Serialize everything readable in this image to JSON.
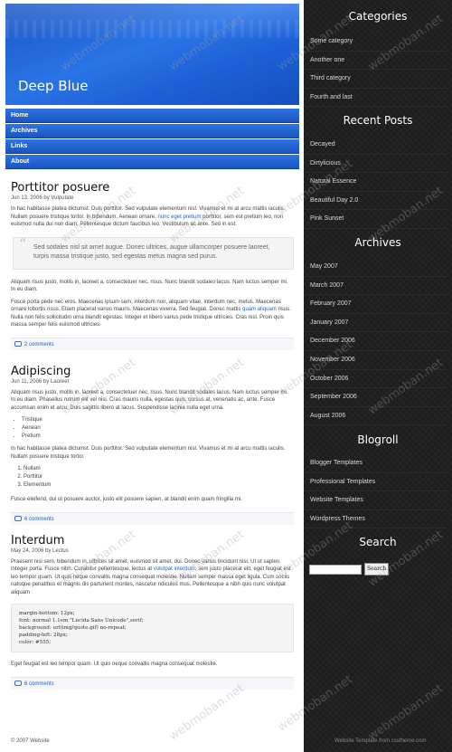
{
  "header": {
    "site_title": "Deep Blue"
  },
  "nav": {
    "items": [
      {
        "label": "Home"
      },
      {
        "label": "Archives"
      },
      {
        "label": "Links"
      },
      {
        "label": "About"
      }
    ]
  },
  "posts": [
    {
      "title": "Porttitor posuere",
      "meta": "Jun 13, 2006 by Vulputate",
      "p1_start": "In hac habitasse platea dictumst. Duis porttitor. Sed vulputate elementum nisl. Vivamus et mi at arcu mattis iaculis. Nullam posuere tristique tortor. In bibendum. Aenean ornare, ",
      "p1_link": "nunc eget pretium",
      "p1_end": " porttitor, sem est pretium leo, non euismod nulla dui non diam. Pellentesque dictum faucibus leo. Vestibulum ac ante. Sed in est.",
      "quote": "Sed sodales nisl sit amet augue. Donec ultrices, augue ullamcorper posuere laoreet, turpis massa tristique justo, sed egestas metus magna sed purus.",
      "p2": "Aliquam risus justo, mollis in, laoreet a, consectetuer nec, risus. Nunc blandit sodales lacus. Nam luctus semper mi. In eu diam.",
      "p3_start": "Fusce porta pede nec eros. Maecenas ipsum sem, interdum non, aliquam vitae, interdum nec, metus. Maecenas ornare lobortis risus. Etiam placerat varius mauris. Maecenas viverra. Sed feugiat. Donec mattis ",
      "p3_link": "quam aliquam",
      "p3_end": " risus. Nulla non felis sollicitudin urna blandit egestas. Integer et libero varius pede tristique ultricies. Cras nisl. Proin quis massa semper felis euismod ultricies.",
      "comments": "2 comments"
    },
    {
      "title": "Adipiscing",
      "meta": "Jun 11, 2006 by Laoreet",
      "p1": "Aliquam risus justo, mollis in, laoreet a, consectetuer nec, risus. Nunc blandit sodales lacus. Nam luctus semper mi. In eu diam. Phasellus rutrum elit vel nisi. Cras mauris nulla, egestas quis, cursus at, venenatis ac, ante. Fusce accumsan enim et arcu. Duis sagittis libero at lacus. Suspendisse lacinia nulla eget urna.",
      "bullets": [
        "Tristique",
        "Aenean",
        "Pretium"
      ],
      "p2": "In hac habitasse platea dictumst. Duis porttitor. Sed vulputate elementum nisl. Vivamus et mi at arcu mattis iaculis. Nullam posuere tristique tortor.",
      "numbered": [
        "Nullam",
        "Porttitor",
        "Elementum"
      ],
      "p3": "Fusce eleifend, dui ut posuere auctor, justo elit posuere sapien, at blandit enim quam fringilla mi.",
      "comments": "6 comments"
    },
    {
      "title": "Interdum",
      "meta": "May 24, 2006 by Lectus",
      "p1_start": "Praesent nisi sem, bibendum in, ultrices sit amet, euismod sit amet, dui. Donec varius tincidunt nisi. Ut ut sapien. Integer porta. Fusce nibh. Curabitur pellentesque, lectus at ",
      "p1_link": "volutpat interdum",
      "p1_end": ", sem justo placerat elit, eget feugiat est leo tempor quam. Ut quis neque convallis magna consequat molestie. Nullam semper massa eget ligula. Cum sociis natoque penatibus et magnis dis parturient montes, nascetur ridiculus mus. Pellentesque a nibh quis nunc volutpat aliquam",
      "code": "margin-bottom: 12px;\nfont: normal 1.1em \"Lucida Sans Unicode\",serif;\nbackground: url(img/quote.gif) no-repeat;\npadding-left: 28px;\ncolor: #555;",
      "p2": "Eget feugiat est leo tempor quam. Ut quis neque convallis magna consequat molestie.",
      "comments": "6 comments"
    }
  ],
  "footer": {
    "copyright": "© 2007 Website",
    "credit": "Website Template from csstheme.com"
  },
  "sidebar": {
    "categories": {
      "heading": "Categories",
      "items": [
        "Some category",
        "Another one",
        "Third category",
        "Fourth and last"
      ]
    },
    "recent": {
      "heading": "Recent Posts",
      "items": [
        "Decayed",
        "Dirtylicious",
        "Natural Essence",
        "Beautiful Day 2.0",
        "Pink Sunset"
      ]
    },
    "archives": {
      "heading": "Archives",
      "items": [
        "May 2007",
        "March 2007",
        "February 2007",
        "January 2007",
        "December 2006",
        "November 2006",
        "October 2006",
        "September 2006",
        "August 2006"
      ]
    },
    "blogroll": {
      "heading": "Blogroll",
      "items": [
        "Blogger Templates",
        "Professional Templates",
        "Website Templates",
        "Wordpress Themes"
      ]
    },
    "search": {
      "heading": "Search",
      "button": "Search",
      "value": ""
    }
  },
  "watermark": "webmoban.net"
}
